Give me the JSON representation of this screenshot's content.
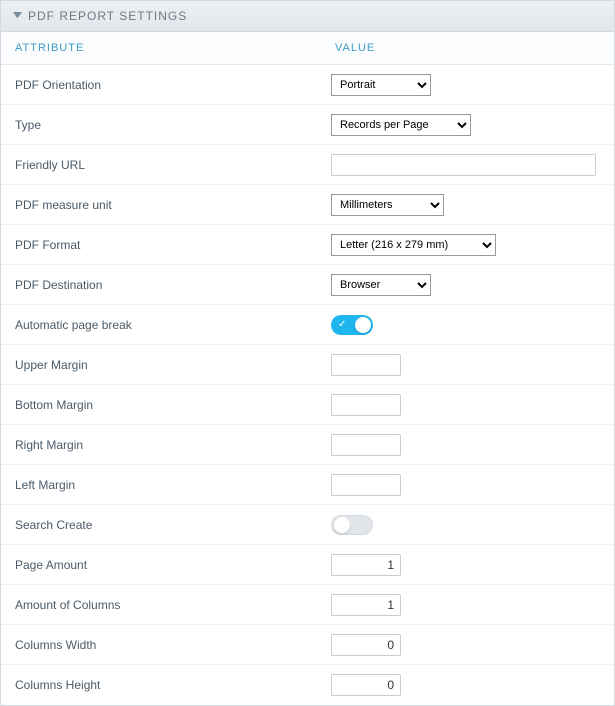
{
  "panel": {
    "title": "PDF REPORT SETTINGS"
  },
  "columns": {
    "attribute": "ATTRIBUTE",
    "value": "VALUE"
  },
  "rows": {
    "pdf_orientation": {
      "label": "PDF Orientation",
      "value": "Portrait"
    },
    "type": {
      "label": "Type",
      "value": "Records per Page"
    },
    "friendly_url": {
      "label": "Friendly URL",
      "value": ""
    },
    "pdf_measure_unit": {
      "label": "PDF measure unit",
      "value": "Millimeters"
    },
    "pdf_format": {
      "label": "PDF Format",
      "value": "Letter (216 x 279 mm)"
    },
    "pdf_destination": {
      "label": "PDF Destination",
      "value": "Browser"
    },
    "auto_page_break": {
      "label": "Automatic page break",
      "value": true
    },
    "upper_margin": {
      "label": "Upper Margin",
      "value": ""
    },
    "bottom_margin": {
      "label": "Bottom Margin",
      "value": ""
    },
    "right_margin": {
      "label": "Right Margin",
      "value": ""
    },
    "left_margin": {
      "label": "Left Margin",
      "value": ""
    },
    "search_create": {
      "label": "Search Create",
      "value": false
    },
    "page_amount": {
      "label": "Page Amount",
      "value": "1"
    },
    "amount_of_columns": {
      "label": "Amount of Columns",
      "value": "1"
    },
    "columns_width": {
      "label": "Columns Width",
      "value": "0"
    },
    "columns_height": {
      "label": "Columns Height",
      "value": "0"
    }
  }
}
